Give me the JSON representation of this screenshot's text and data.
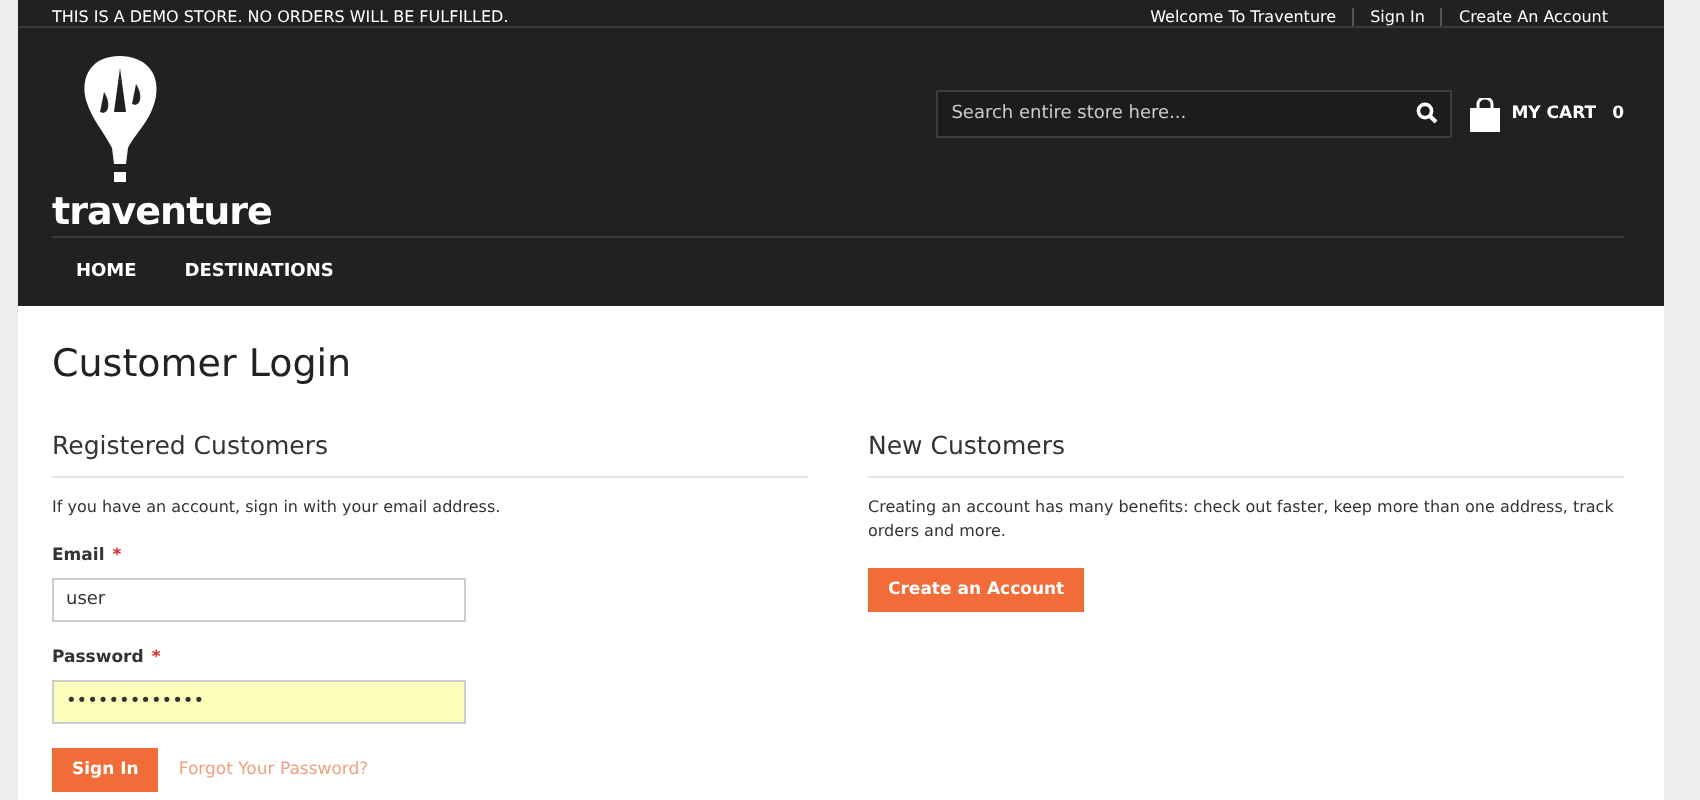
{
  "top_bar": {
    "notice": "THIS IS A DEMO STORE. NO ORDERS WILL BE FULFILLED.",
    "links": [
      "Welcome To Traventure",
      "Sign In",
      "Create An Account"
    ]
  },
  "header": {
    "logo_text": "traventure",
    "search": {
      "placeholder": "Search entire store here..."
    },
    "cart": {
      "label": "MY CART",
      "count": "0"
    }
  },
  "nav": [
    "HOME",
    "DESTINATIONS"
  ],
  "page_title": "Customer Login",
  "registered": {
    "title": "Registered Customers",
    "intro": "If you have an account, sign in with your email address.",
    "fields": [
      {
        "label": "Email",
        "required": "*",
        "value": "user",
        "autofilled": false
      },
      {
        "label": "Password",
        "required": "*",
        "value": "•••••••••••••",
        "autofilled": true
      }
    ],
    "button": "Sign In",
    "link": "Forgot Your Password?"
  },
  "new_customers": {
    "title": "New Customers",
    "text": "Creating an account has many benefits: check out faster, keep more than one address, track orders and more.",
    "button": "Create an Account"
  }
}
